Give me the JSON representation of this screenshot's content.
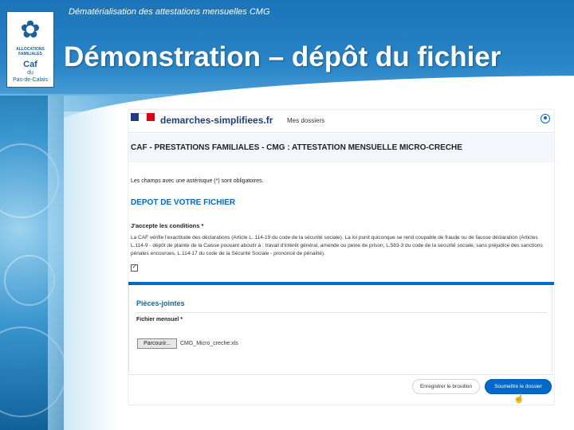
{
  "slide": {
    "subtitle": "Dématérialisation des attestations mensuelles CMG",
    "title": "Démonstration – dépôt du fichier"
  },
  "logo": {
    "line1": "ALLOCATIONS FAMILIALES",
    "caf": "Caf",
    "du": "du",
    "dept": "Pas-de-Calais"
  },
  "screenshot": {
    "brand": "demarches-simplifiees.fr",
    "nav_mes_dossiers": "Mes dossiers",
    "procedure_title": "CAF - PRESTATIONS FAMILIALES - CMG : ATTESTATION MENSUELLE MICRO-CRECHE",
    "mandatory_notice": "Les champs avec une astérisque (*) sont obligatoires.",
    "section_depot": "DEPOT DE VOTRE FICHIER",
    "accept_label": "J'accepte les conditions *",
    "legal_text": "La CAF vérifie l'exactitude des déclarations (Article L. 114-19 du code de la sécurité sociale). La loi punit quiconque se rend coupable de fraude ou de fausse déclaration (Articles L.114-9 - dépôt de plainte de la Caisse pouvant aboutir à : travail d'intérêt général, amende ou peine de prison, L.583-3 du code de la sécurité sociale, sans préjudice des sanctions pénales encourues, L.114-17 du code de la Sécurité Sociale - prononcé de pénalité).",
    "checkbox_mark": "✓",
    "attachments_title": "Pièces-jointes",
    "file_label": "Fichier mensuel *",
    "browse_button": "Parcourir...",
    "file_name": "CMG_Micro_creche.xls",
    "draft_button": "Enregistrer le brouillon",
    "submit_button": "Soumettre le dossier",
    "colors": {
      "primary": "#0069cc",
      "brand": "#1d3c87"
    }
  }
}
